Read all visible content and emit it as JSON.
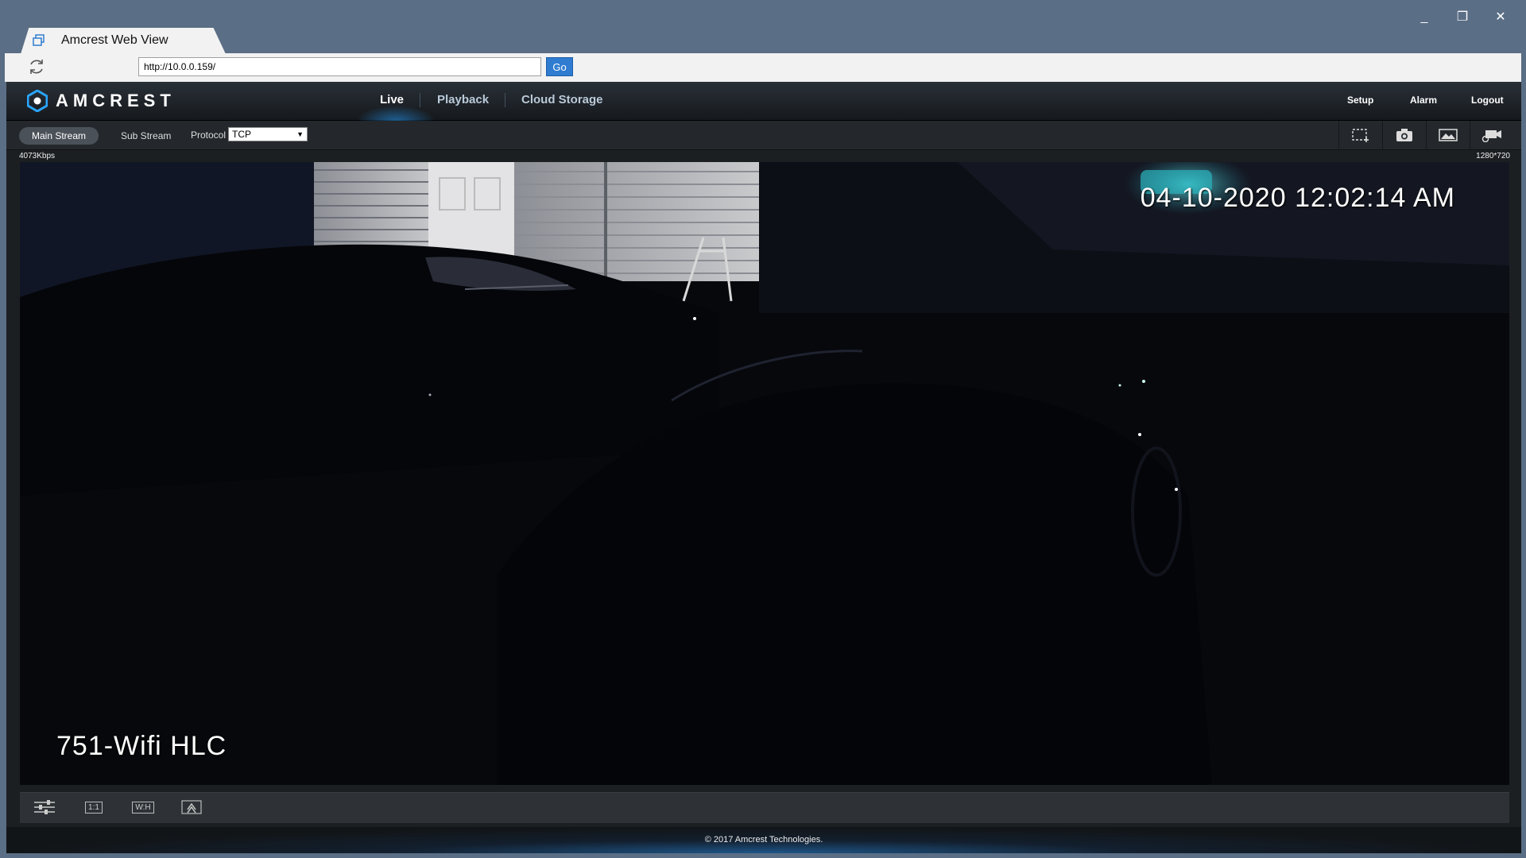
{
  "window": {
    "tab_title": "Amcrest Web View",
    "minimize_glyph": "_",
    "maximize_glyph": "❐",
    "close_glyph": "✕"
  },
  "addressbar": {
    "url": "http://10.0.0.159/",
    "go_label": "Go"
  },
  "brand": {
    "name": "AMCREST",
    "accent": "#2aa6ff"
  },
  "nav": {
    "live": "Live",
    "playback": "Playback",
    "cloud": "Cloud Storage",
    "setup": "Setup",
    "alarm": "Alarm",
    "logout": "Logout"
  },
  "toolbar": {
    "main_stream": "Main Stream",
    "sub_stream": "Sub Stream",
    "protocol_label": "Protocol",
    "protocol_value": "TCP",
    "icons": [
      "region-zoom-icon",
      "snapshot-icon",
      "image-adjust-icon",
      "record-icon"
    ]
  },
  "stream": {
    "bitrate": "4073Kbps",
    "resolution": "1280*720",
    "osd_timestamp": "04-10-2020 12:02:14 AM",
    "osd_camera_name": "751-Wifi HLC"
  },
  "bottombar": {
    "icons": [
      "image-settings-icon",
      "original-size-icon",
      "fit-window-icon",
      "fullscreen-icon"
    ],
    "original_size_glyph": "1:1",
    "fit_glyph": "W:H"
  },
  "footer": {
    "copyright": "© 2017 Amcrest Technologies."
  }
}
